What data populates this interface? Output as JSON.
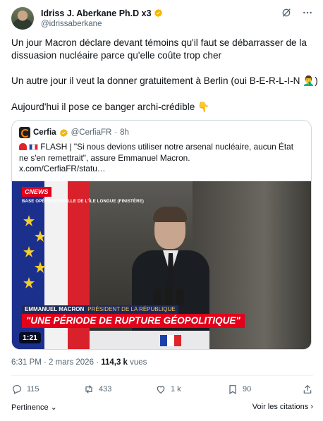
{
  "author": {
    "name": "Idriss J. Aberkane Ph.D x3",
    "handle": "@idrissaberkane"
  },
  "tweet": {
    "paragraph1": "Un jour Macron déclare devant témoins qu'il faut se débarrasser de la dissuasion nucléaire parce qu'elle coûte trop cher",
    "paragraph2": "Un autre jour il veut la donner gratuitement à Berlin (oui B-E-R-L-I-N 🤦‍♂️)",
    "paragraph3": "Aujourd'hui il pose ce banger archi-crédible 👇"
  },
  "quote": {
    "name": "Cerfia",
    "handle": "@CerfiaFR",
    "time": "8h",
    "text_prefix": "FLASH | \"Si nous devions utiliser notre arsenal nucléaire, aucun État ne s'en remettrait\", assure Emmanuel Macron.",
    "link": "x.com/CerfiaFR/statu…",
    "video": {
      "channel_c": "C",
      "channel_news": "NEWS",
      "location_tag": "BASE OPÉRATIONNELLE DE L'ÎLE LONGUE (FINISTÈRE)",
      "lower_third_name": "EMMANUEL MACRON",
      "lower_third_role": "PRÉSIDENT DE LA RÉPUBLIQUE",
      "headline": "\"UNE PÉRIODE DE RUPTURE GÉOPOLITIQUE\"",
      "duration": "1:21"
    }
  },
  "meta": {
    "timestamp": "6:31 PM · 2 mars 2026 · ",
    "views_count": "114,3 k",
    "views_label": " vues"
  },
  "actions": {
    "replies": "115",
    "reposts": "433",
    "likes": "1 k",
    "bookmarks": "90"
  },
  "footer": {
    "engagement": "Pertinence",
    "quotes_link": "Voir les citations"
  },
  "colors": {
    "text": "#0f1419",
    "secondary": "#536471",
    "verified": "#f4b400",
    "cnews_red": "#e2001a"
  }
}
